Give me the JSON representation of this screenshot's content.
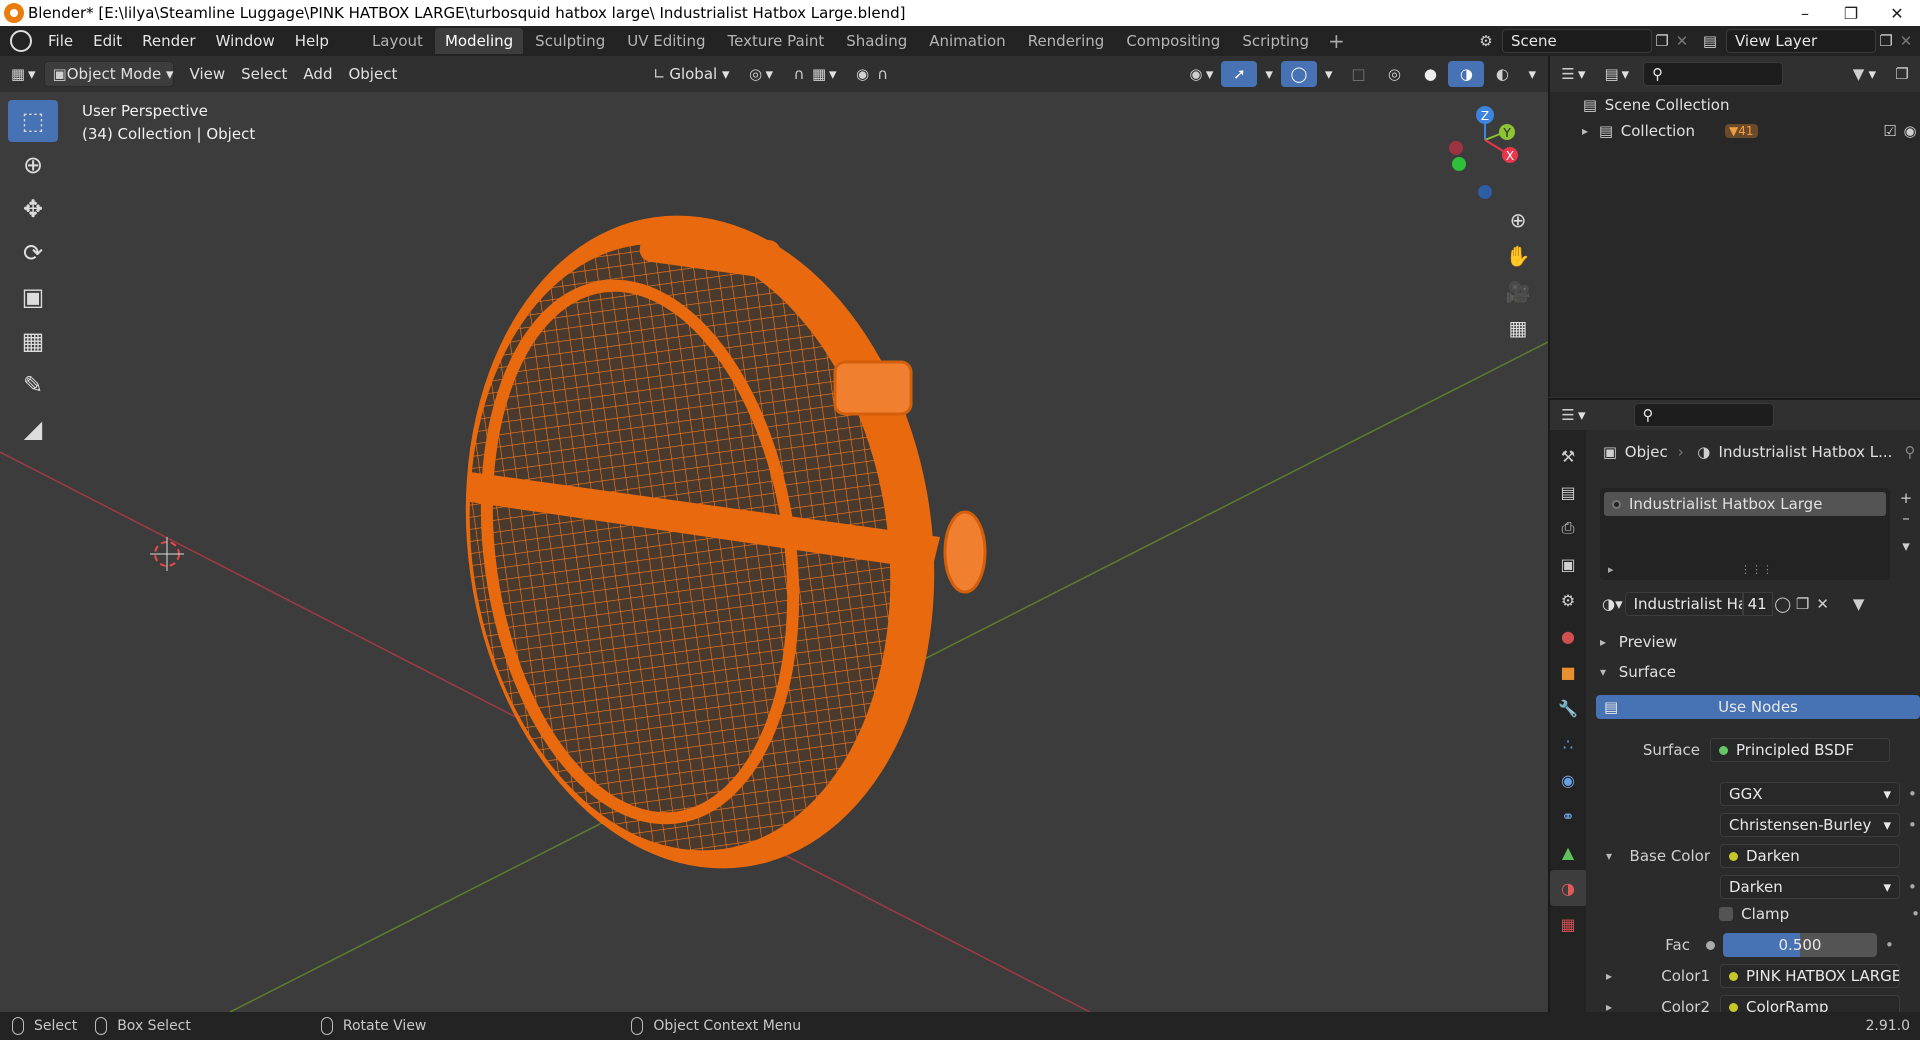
{
  "window": {
    "title": "Blender* [E:\\lilya\\Steamline Luggage\\PINK HATBOX LARGE\\turbosquid hatbox large\\ Industrialist Hatbox Large.blend]"
  },
  "menu": [
    "File",
    "Edit",
    "Render",
    "Window",
    "Help"
  ],
  "workspaces": [
    {
      "label": "Layout",
      "active": false
    },
    {
      "label": "Modeling",
      "active": true
    },
    {
      "label": "Sculpting",
      "active": false
    },
    {
      "label": "UV Editing",
      "active": false
    },
    {
      "label": "Texture Paint",
      "active": false
    },
    {
      "label": "Shading",
      "active": false
    },
    {
      "label": "Animation",
      "active": false
    },
    {
      "label": "Rendering",
      "active": false
    },
    {
      "label": "Compositing",
      "active": false
    },
    {
      "label": "Scripting",
      "active": false
    }
  ],
  "scene": {
    "name": "Scene",
    "view_layer": "View Layer"
  },
  "viewport_header": {
    "mode": "Object Mode",
    "menus": [
      "View",
      "Select",
      "Add",
      "Object"
    ],
    "transform_orientation": "Global"
  },
  "viewport": {
    "perspective": "User Perspective",
    "collection_info": "(34) Collection | Object",
    "axes": {
      "z": "Z",
      "y": "Y",
      "x": "X"
    },
    "colors": {
      "x_axis": "#e8364b",
      "y_axis": "#8bc534",
      "z_axis": "#3d83e0",
      "wire": "#ff7a1a",
      "selected": "#e96a0e"
    }
  },
  "outliner": {
    "scene_collection": "Scene Collection",
    "collection": "Collection",
    "object_count": "41"
  },
  "properties": {
    "breadcrumb_object": "Objec",
    "breadcrumb_material": "Industrialist Hatbox L...",
    "material_slot": "Industrialist Hatbox Large",
    "material_name": "Industrialist Ha...",
    "material_users": "41",
    "panels": {
      "preview": "Preview",
      "surface": "Surface"
    },
    "use_nodes": "Use Nodes",
    "surface_label": "Surface",
    "surface_value": "Principled BSDF",
    "distribution": "GGX",
    "subsurface": "Christensen-Burley",
    "base_color_label": "Base Color",
    "base_color_value": "Darken",
    "blend_mode": "Darken",
    "clamp": "Clamp",
    "fac_label": "Fac",
    "fac_value": "0.500",
    "fac_fraction": 0.5,
    "color1_label": "Color1",
    "color1_value": "PINK HATBOX LARGE_...",
    "color2_label": "Color2",
    "color2_value": "ColorRamp"
  },
  "statusbar": {
    "select": "Select",
    "box_select": "Box Select",
    "rotate_view": "Rotate View",
    "context_menu": "Object Context Menu",
    "version": "2.91.0"
  }
}
